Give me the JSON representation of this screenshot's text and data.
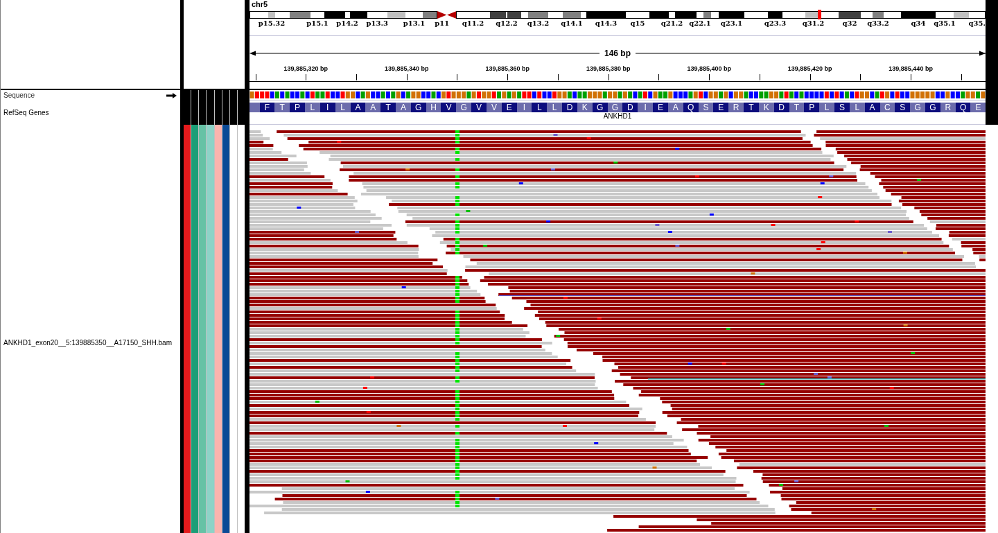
{
  "header": {
    "chromosome": "chr5",
    "ideogram": {
      "bands": [
        {
          "kind": "band",
          "color": "#ffffff",
          "current": false
        },
        {
          "kind": "band",
          "color": "#c0c0c0",
          "current": false,
          "label": "p15.32"
        },
        {
          "kind": "band",
          "color": "#ffffff",
          "current": false
        },
        {
          "kind": "band",
          "color": "#808080",
          "current": false
        },
        {
          "kind": "band",
          "color": "#ffffff",
          "current": false,
          "label": "p15.1"
        },
        {
          "kind": "band",
          "color": "#000000",
          "current": false
        },
        {
          "kind": "band",
          "color": "#ffffff",
          "current": false,
          "label": "p14.2"
        },
        {
          "kind": "band",
          "color": "#000000",
          "current": false
        },
        {
          "kind": "band",
          "color": "#ffffff",
          "current": false,
          "label": "p13.3"
        },
        {
          "kind": "band",
          "color": "#c0c0c0",
          "current": false
        },
        {
          "kind": "band",
          "color": "#ffffff",
          "current": false,
          "label": "p13.1"
        },
        {
          "kind": "band",
          "color": "#808080",
          "current": false
        },
        {
          "kind": "pcen",
          "color": "#b40000",
          "current": false,
          "label": "p11"
        },
        {
          "kind": "qcen",
          "color": "#b40000",
          "current": false
        },
        {
          "kind": "band",
          "color": "#ffffff",
          "current": false,
          "label": "q11.2"
        },
        {
          "kind": "band",
          "color": "#404040",
          "current": false
        },
        {
          "kind": "band",
          "color": "#ffffff",
          "current": false,
          "label": "q12.2"
        },
        {
          "kind": "band",
          "color": "#404040",
          "current": false
        },
        {
          "kind": "band",
          "color": "#ffffff",
          "current": false
        },
        {
          "kind": "band",
          "color": "#808080",
          "current": false,
          "label": "q13.2"
        },
        {
          "kind": "band",
          "color": "#ffffff",
          "current": false
        },
        {
          "kind": "band",
          "color": "#808080",
          "current": false,
          "label": "q14.1"
        },
        {
          "kind": "band",
          "color": "#ffffff",
          "current": false
        },
        {
          "kind": "band",
          "color": "#000000",
          "current": false,
          "label": "q14.3"
        },
        {
          "kind": "band",
          "color": "#ffffff",
          "current": false,
          "label": "q15"
        },
        {
          "kind": "band",
          "color": "#000000",
          "current": false
        },
        {
          "kind": "band",
          "color": "#ffffff",
          "current": false,
          "label": "q21.2"
        },
        {
          "kind": "band",
          "color": "#000000",
          "current": false
        },
        {
          "kind": "band",
          "color": "#ffffff",
          "current": false,
          "label": "q22.1"
        },
        {
          "kind": "band",
          "color": "#808080",
          "current": false
        },
        {
          "kind": "band",
          "color": "#ffffff",
          "current": false
        },
        {
          "kind": "band",
          "color": "#000000",
          "current": false,
          "label": "q23.1"
        },
        {
          "kind": "band",
          "color": "#ffffff",
          "current": false
        },
        {
          "kind": "band",
          "color": "#000000",
          "current": false,
          "label": "q23.3"
        },
        {
          "kind": "band",
          "color": "#ffffff",
          "current": false
        },
        {
          "kind": "band",
          "color": "#c0c0c0",
          "current": true,
          "label": "q31.2"
        },
        {
          "kind": "band",
          "color": "#ffffff",
          "current": false
        },
        {
          "kind": "band",
          "color": "#404040",
          "current": false,
          "label": "q32"
        },
        {
          "kind": "band",
          "color": "#ffffff",
          "current": false
        },
        {
          "kind": "band",
          "color": "#808080",
          "current": false,
          "label": "q33.2"
        },
        {
          "kind": "band",
          "color": "#ffffff",
          "current": false
        },
        {
          "kind": "band",
          "color": "#000000",
          "current": false,
          "label": "q34"
        },
        {
          "kind": "band",
          "color": "#ffffff",
          "current": false,
          "label": "q35.1"
        },
        {
          "kind": "band",
          "color": "#c0c0c0",
          "current": false
        },
        {
          "kind": "band",
          "color": "#ffffff",
          "current": false,
          "label": "q35."
        }
      ]
    },
    "ruler": {
      "span": "146 bp",
      "ticks": [
        "139,885,320 bp",
        "139,885,340 bp",
        "139,885,360 bp",
        "139,885,380 bp",
        "139,885,400 bp",
        "139,885,420 bp",
        "139,885,440 bp"
      ]
    }
  },
  "tracks": [
    {
      "name": "Sequence",
      "kind": "sequence",
      "forward_strand": true
    },
    {
      "name": "RefSeq Genes",
      "kind": "genes"
    },
    {
      "name": "ANKHD1_exon20__5:139885350__A17150_SHH.bam",
      "kind": "alignment"
    }
  ],
  "attributes": [
    {
      "color": "#e41a1c"
    },
    {
      "color": "#1b9e77"
    },
    {
      "color": "#66c2a5"
    },
    {
      "color": "#8dd3c7"
    },
    {
      "color": "#fbb4ae"
    },
    {
      "color": "#0b4a96"
    },
    {
      "color": "#ffffff"
    },
    {
      "color": "#ffffff"
    }
  ],
  "sequence_track": {
    "bases": [
      {
        "color": "#d17105"
      },
      {
        "color": "#ff0000"
      },
      {
        "color": "#ff0000"
      },
      {
        "color": "#ff0000"
      },
      {
        "color": "#0000ff"
      },
      {
        "color": "#00a000"
      },
      {
        "color": "#0000ff"
      },
      {
        "color": "#00a000"
      },
      {
        "color": "#0000ff"
      },
      {
        "color": "#0000ff"
      },
      {
        "color": "#00a000"
      },
      {
        "color": "#0000ff"
      },
      {
        "color": "#ff0000"
      },
      {
        "color": "#00a000"
      },
      {
        "color": "#00a000"
      },
      {
        "color": "#ff0000"
      },
      {
        "color": "#0000ff"
      },
      {
        "color": "#0000ff"
      },
      {
        "color": "#ff0000"
      },
      {
        "color": "#d17105"
      },
      {
        "color": "#d17105"
      },
      {
        "color": "#0000ff"
      },
      {
        "color": "#00a000"
      },
      {
        "color": "#d17105"
      },
      {
        "color": "#0000ff"
      },
      {
        "color": "#0000ff"
      },
      {
        "color": "#00a000"
      },
      {
        "color": "#0000ff"
      },
      {
        "color": "#00a000"
      },
      {
        "color": "#d17105"
      },
      {
        "color": "#0000ff"
      },
      {
        "color": "#00a000"
      },
      {
        "color": "#d17105"
      },
      {
        "color": "#d17105"
      },
      {
        "color": "#0000ff"
      },
      {
        "color": "#0000ff"
      },
      {
        "color": "#00a000"
      },
      {
        "color": "#0000ff"
      },
      {
        "color": "#d17105"
      },
      {
        "color": "#ff0000"
      },
      {
        "color": "#d17105"
      },
      {
        "color": "#d17105"
      },
      {
        "color": "#d17105"
      },
      {
        "color": "#00a000"
      },
      {
        "color": "#d17105"
      },
      {
        "color": "#ff0000"
      },
      {
        "color": "#d17105"
      },
      {
        "color": "#d17105"
      },
      {
        "color": "#ff0000"
      },
      {
        "color": "#00a000"
      },
      {
        "color": "#d17105"
      },
      {
        "color": "#00a000"
      },
      {
        "color": "#d17105"
      },
      {
        "color": "#00a000"
      },
      {
        "color": "#ff0000"
      },
      {
        "color": "#ff0000"
      },
      {
        "color": "#0000ff"
      },
      {
        "color": "#ff0000"
      },
      {
        "color": "#0000ff"
      },
      {
        "color": "#0000ff"
      },
      {
        "color": "#ff0000"
      },
      {
        "color": "#d17105"
      },
      {
        "color": "#d17105"
      },
      {
        "color": "#00a000"
      },
      {
        "color": "#0000ff"
      },
      {
        "color": "#00a000"
      },
      {
        "color": "#00a000"
      },
      {
        "color": "#d17105"
      },
      {
        "color": "#d17105"
      },
      {
        "color": "#d17105"
      },
      {
        "color": "#00a000"
      },
      {
        "color": "#d17105"
      },
      {
        "color": "#d17105"
      },
      {
        "color": "#00a000"
      },
      {
        "color": "#d17105"
      },
      {
        "color": "#00a000"
      },
      {
        "color": "#0000ff"
      },
      {
        "color": "#00a000"
      },
      {
        "color": "#ff0000"
      },
      {
        "color": "#0000ff"
      },
      {
        "color": "#d17105"
      },
      {
        "color": "#00a000"
      },
      {
        "color": "#00a000"
      },
      {
        "color": "#d17105"
      },
      {
        "color": "#0000ff"
      },
      {
        "color": "#0000ff"
      },
      {
        "color": "#0000ff"
      },
      {
        "color": "#00a000"
      },
      {
        "color": "#d17105"
      },
      {
        "color": "#ff0000"
      },
      {
        "color": "#0000ff"
      },
      {
        "color": "#d17105"
      },
      {
        "color": "#d17105"
      },
      {
        "color": "#00a000"
      },
      {
        "color": "#d17105"
      },
      {
        "color": "#0000ff"
      },
      {
        "color": "#d17105"
      },
      {
        "color": "#d17105"
      },
      {
        "color": "#00a000"
      },
      {
        "color": "#0000ff"
      },
      {
        "color": "#0000ff"
      },
      {
        "color": "#00a000"
      },
      {
        "color": "#00a000"
      },
      {
        "color": "#d17105"
      },
      {
        "color": "#d17105"
      },
      {
        "color": "#00a000"
      },
      {
        "color": "#ff0000"
      },
      {
        "color": "#00a000"
      },
      {
        "color": "#0000ff"
      },
      {
        "color": "#00a000"
      },
      {
        "color": "#0000ff"
      },
      {
        "color": "#0000ff"
      },
      {
        "color": "#0000ff"
      },
      {
        "color": "#0000ff"
      },
      {
        "color": "#ff0000"
      },
      {
        "color": "#0000ff"
      },
      {
        "color": "#ff0000"
      },
      {
        "color": "#0000ff"
      },
      {
        "color": "#00a000"
      },
      {
        "color": "#0000ff"
      },
      {
        "color": "#ff0000"
      },
      {
        "color": "#d17105"
      },
      {
        "color": "#d17105"
      },
      {
        "color": "#0000ff"
      },
      {
        "color": "#00a000"
      },
      {
        "color": "#ff0000"
      },
      {
        "color": "#d17105"
      },
      {
        "color": "#0000ff"
      },
      {
        "color": "#ff0000"
      },
      {
        "color": "#0000ff"
      },
      {
        "color": "#0000ff"
      },
      {
        "color": "#d17105"
      },
      {
        "color": "#d17105"
      },
      {
        "color": "#d17105"
      },
      {
        "color": "#d17105"
      },
      {
        "color": "#d17105"
      },
      {
        "color": "#0000ff"
      },
      {
        "color": "#0000ff"
      },
      {
        "color": "#d17105"
      },
      {
        "color": "#0000ff"
      },
      {
        "color": "#0000ff"
      },
      {
        "color": "#00a000"
      },
      {
        "color": "#d17105"
      },
      {
        "color": "#d17105"
      },
      {
        "color": "#00a000"
      },
      {
        "color": "#d17105"
      }
    ]
  },
  "gene_track": {
    "amino_acids": [
      "F",
      "T",
      "P",
      "L",
      "I",
      "L",
      "A",
      "A",
      "T",
      "A",
      "G",
      "H",
      "V",
      "G",
      "V",
      "V",
      "E",
      "I",
      "L",
      "L",
      "D",
      "K",
      "G",
      "G",
      "D",
      "I",
      "E",
      "A",
      "Q",
      "S",
      "E",
      "R",
      "T",
      "K",
      "D",
      "T",
      "P",
      "L",
      "S",
      "L",
      "A",
      "C",
      "S",
      "G",
      "G",
      "R",
      "Q",
      "E"
    ],
    "gene": "ANKHD1"
  }
}
